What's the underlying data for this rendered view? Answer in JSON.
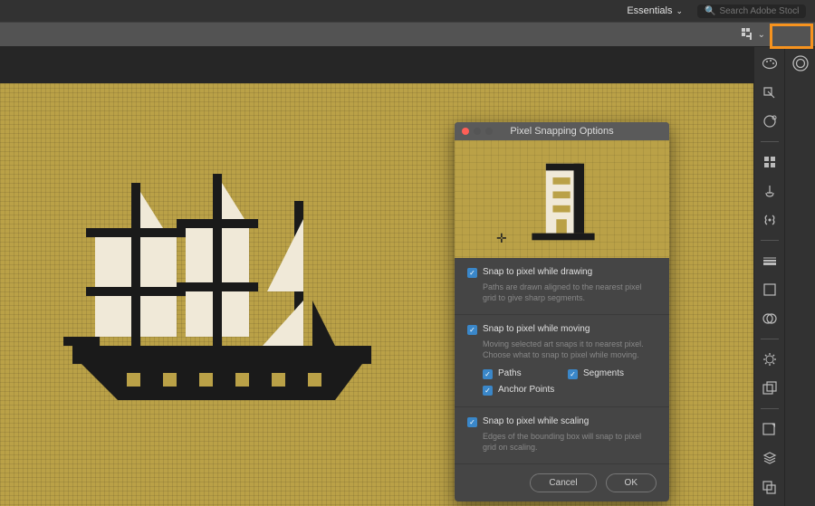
{
  "topbar": {
    "workspace_label": "Essentials",
    "search_placeholder": "Search Adobe Stock"
  },
  "dialog": {
    "title": "Pixel Snapping Options",
    "section1": {
      "label": "Snap to pixel while drawing",
      "desc": "Paths are drawn aligned to the nearest pixel grid to give sharp segments."
    },
    "section2": {
      "label": "Snap to pixel while moving",
      "desc": "Moving selected art snaps it to nearest pixel. Choose what to snap to pixel while moving.",
      "sub": {
        "paths": "Paths",
        "segments": "Segments",
        "anchor_points": "Anchor Points"
      }
    },
    "section3": {
      "label": "Snap to pixel while scaling",
      "desc": "Edges of the bounding box will snap to pixel grid on scaling."
    },
    "cancel": "Cancel",
    "ok": "OK"
  },
  "panels": {
    "palette": "palette-icon",
    "cc": "cc-icon",
    "color": "color-icon",
    "swatches": "swatches-icon",
    "brushes": "brushes-icon",
    "symbols": "symbols-icon",
    "stroke": "stroke-icon",
    "gradient": "gradient-icon",
    "transparency": "transparency-icon",
    "appearance": "appearance-icon",
    "graphic_styles": "graphic-styles-icon",
    "libraries": "libraries-icon",
    "layers": "layers-icon",
    "artboards": "artboards-icon"
  },
  "accent": "#f7931e",
  "checkbox_color": "#3a87c9"
}
